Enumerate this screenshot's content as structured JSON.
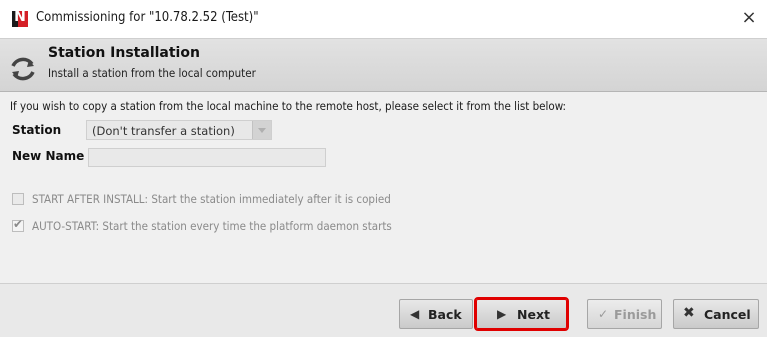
{
  "window": {
    "title": "Commissioning for \"10.78.2.52 (Test)\"",
    "close_glyph": "×",
    "logo_letter": "N"
  },
  "header": {
    "title": "Station Installation",
    "subtitle": "Install a station from the local computer",
    "icon": "refresh-icon"
  },
  "content": {
    "instruction": "If you wish to copy a station from the local machine to the remote host, please select it from the list below:",
    "station_label": "Station",
    "station_selected": "(Don't transfer a station)",
    "new_name_label": "New Name",
    "new_name_value": "",
    "options": [
      {
        "label": "START AFTER INSTALL: Start the station immediately after it is copied",
        "checked": false
      },
      {
        "label": "AUTO-START: Start the station every time the platform daemon starts",
        "checked": true
      }
    ]
  },
  "footer": {
    "back_label": "Back",
    "next_label": "Next",
    "finish_label": "Finish",
    "cancel_label": "Cancel"
  },
  "colors": {
    "highlight": "#e00000",
    "brand_red": "#d51f26"
  }
}
